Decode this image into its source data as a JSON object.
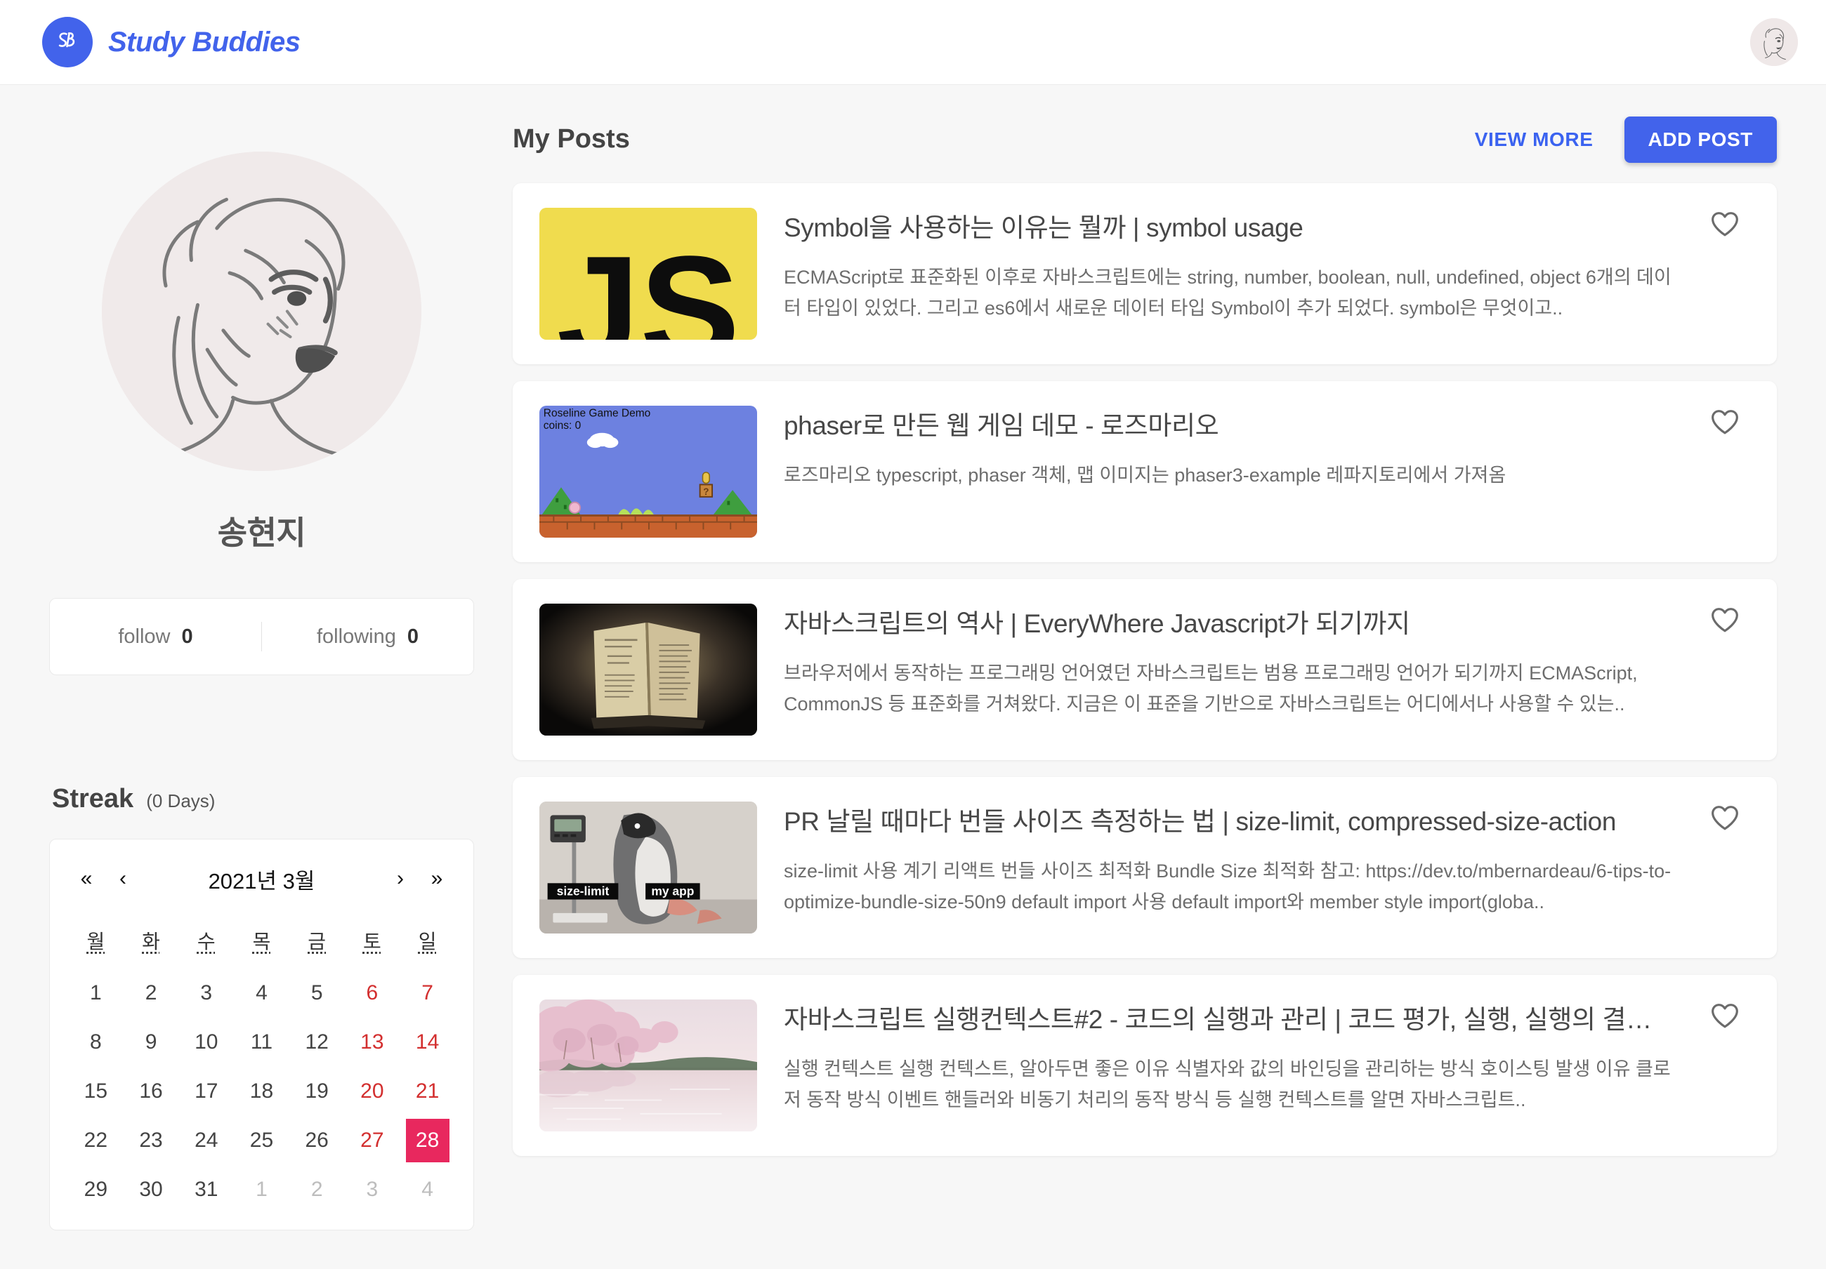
{
  "header": {
    "brand_name": "Study Buddies",
    "logo_text": "SB",
    "avatar_alt": "pencil-sketch-portrait"
  },
  "sidebar": {
    "profile_name": "송현지",
    "stats": [
      {
        "label": "follow",
        "value": "0"
      },
      {
        "label": "following",
        "value": "0"
      }
    ],
    "streak": {
      "title": "Streak",
      "subtitle": "(0 Days)"
    },
    "calendar": {
      "nav": {
        "first": "«",
        "prev": "‹",
        "title": "2021년 3월",
        "next": "›",
        "last": "»"
      },
      "weekdays": [
        "월",
        "화",
        "수",
        "목",
        "금",
        "토",
        "일"
      ],
      "weeks": [
        [
          {
            "d": "1",
            "t": "normal"
          },
          {
            "d": "2",
            "t": "normal"
          },
          {
            "d": "3",
            "t": "normal"
          },
          {
            "d": "4",
            "t": "normal"
          },
          {
            "d": "5",
            "t": "normal"
          },
          {
            "d": "6",
            "t": "weekend"
          },
          {
            "d": "7",
            "t": "weekend"
          }
        ],
        [
          {
            "d": "8",
            "t": "normal"
          },
          {
            "d": "9",
            "t": "normal"
          },
          {
            "d": "10",
            "t": "normal"
          },
          {
            "d": "11",
            "t": "normal"
          },
          {
            "d": "12",
            "t": "normal"
          },
          {
            "d": "13",
            "t": "weekend"
          },
          {
            "d": "14",
            "t": "weekend"
          }
        ],
        [
          {
            "d": "15",
            "t": "normal"
          },
          {
            "d": "16",
            "t": "normal"
          },
          {
            "d": "17",
            "t": "normal"
          },
          {
            "d": "18",
            "t": "normal"
          },
          {
            "d": "19",
            "t": "normal"
          },
          {
            "d": "20",
            "t": "weekend"
          },
          {
            "d": "21",
            "t": "weekend"
          }
        ],
        [
          {
            "d": "22",
            "t": "normal"
          },
          {
            "d": "23",
            "t": "normal"
          },
          {
            "d": "24",
            "t": "normal"
          },
          {
            "d": "25",
            "t": "normal"
          },
          {
            "d": "26",
            "t": "normal"
          },
          {
            "d": "27",
            "t": "weekend"
          },
          {
            "d": "28",
            "t": "today"
          }
        ],
        [
          {
            "d": "29",
            "t": "normal"
          },
          {
            "d": "30",
            "t": "normal"
          },
          {
            "d": "31",
            "t": "normal"
          },
          {
            "d": "1",
            "t": "outside"
          },
          {
            "d": "2",
            "t": "outside"
          },
          {
            "d": "3",
            "t": "outside"
          },
          {
            "d": "4",
            "t": "outside"
          }
        ]
      ]
    }
  },
  "main": {
    "title": "My Posts",
    "view_more_label": "VIEW MORE",
    "add_post_label": "ADD POST",
    "posts": [
      {
        "title": "Symbol을 사용하는 이유는 뭘까 | symbol usage",
        "desc": "ECMAScript로 표준화된 이후로 자바스크립트에는 string, number, boolean, null, undefined, object 6개의 데이터 타입이 있었다. 그리고 es6에서 새로운 데이터 타입 Symbol이 추가 되었다. symbol은 무엇이고..",
        "thumb": "js-logo",
        "thumb_text": "JS",
        "liked": false
      },
      {
        "title": "phaser로 만든 웹 게임 데모 - 로즈마리오",
        "desc": "로즈마리오 typescript, phaser 객체, 맵 이미지는 phaser3-example 레파지토리에서 가져옴",
        "thumb": "game-demo",
        "thumb_text": "Roseline Game Demo / coins: 0",
        "liked": false
      },
      {
        "title": "자바스크립트의 역사 | EveryWhere Javascript가 되기까지",
        "desc": "브라우저에서 동작하는 프로그래밍 언어였던 자바스크립트는 범용 프로그래밍 언어가 되기까지 ECMAScript, CommonJS 등 표준화를 거쳐왔다. 지금은 이 표준을 기반으로 자바스크립트는 어디에서나 사용할 수 있는..",
        "thumb": "old-book",
        "thumb_text": "",
        "liked": false
      },
      {
        "title": "PR 날릴 때마다 번들 사이즈 측정하는 법 | size-limit, compressed-size-action",
        "desc": "size-limit 사용 계기 리액트 번들 사이즈 최적화 Bundle Size 최적화 참고: https://dev.to/mbernardeau/6-tips-to-optimize-bundle-size-50n9 default import 사용 default import와 member style import(globa..",
        "thumb": "penguin-scale",
        "thumb_text": "size-limit / my app",
        "liked": false
      },
      {
        "title": "자바스크립트 실행컨텍스트#2 - 코드의 실행과 관리 | 코드 평가, 실행, 실행의 결…",
        "desc": "실행 컨텍스트 실행 컨텍스트, 알아두면 좋은 이유 식별자와 값의 바인딩을 관리하는 방식 호이스팅 발생 이유 클로저 동작 방식 이벤트 핸들러와 비동기 처리의 동작 방식 등 실행 컨텍스트를 알면 자바스크립트..",
        "thumb": "cherry-blossom",
        "thumb_text": "",
        "liked": false
      }
    ]
  },
  "colors": {
    "brand_blue": "#4263eb",
    "link_blue": "#3b63f0",
    "today_pink": "#e8285e",
    "weekend_red": "#d32f2f",
    "js_yellow": "#f0dc4e",
    "page_bg": "#f7f7f7"
  }
}
